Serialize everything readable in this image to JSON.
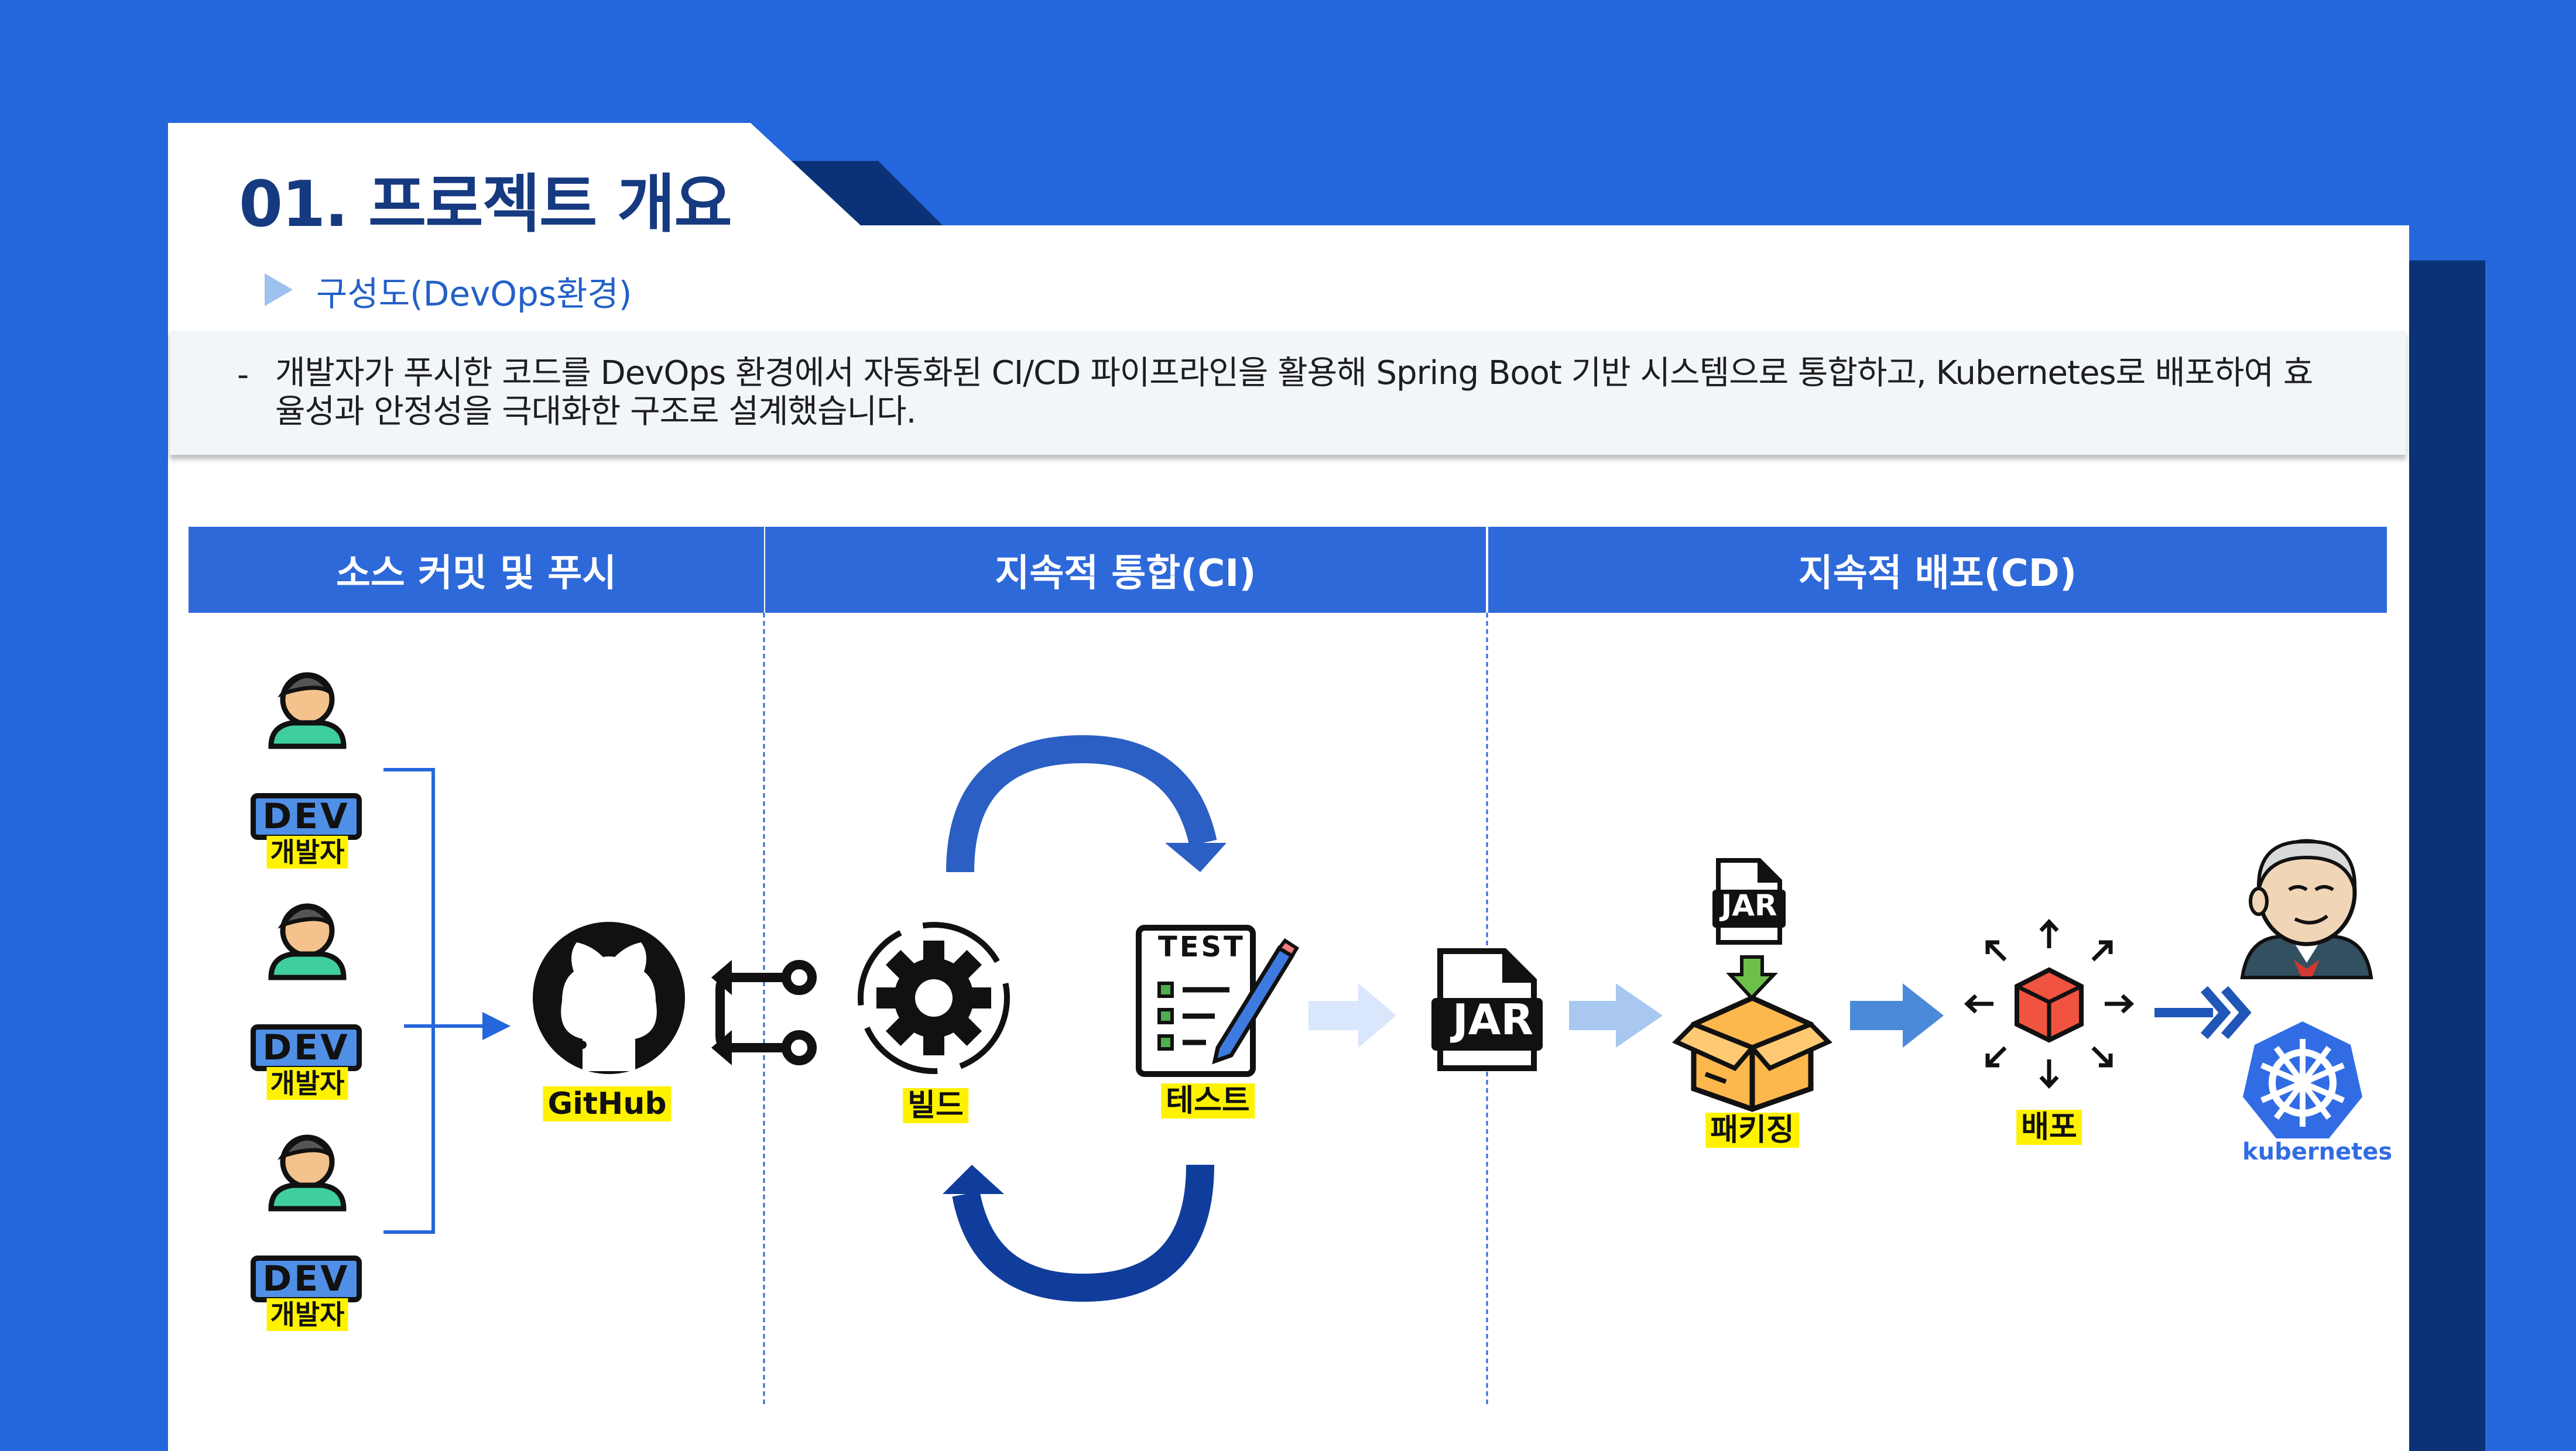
{
  "header": {
    "title": "01. 프로젝트 개요",
    "subtitle": "구성도(DevOps환경)"
  },
  "description": {
    "bullet": "-",
    "text": "개발자가 푸시한 코드를 DevOps 환경에서 자동화된 CI/CD 파이프라인을 활용해 Spring Boot 기반 시스템으로 통합하고, Kubernetes로 배포하여 효율성과 안정성을 극대화한 구조로 설계했습니다."
  },
  "phases": [
    {
      "label": "소스 커밋 및 푸시"
    },
    {
      "label": "지속적 통합(CI)"
    },
    {
      "label": "지속적 배포(CD)"
    }
  ],
  "developers": [
    {
      "badge": "DEV",
      "label": "개발자"
    },
    {
      "badge": "DEV",
      "label": "개발자"
    },
    {
      "badge": "DEV",
      "label": "개발자"
    }
  ],
  "nodes": {
    "github": "GitHub",
    "build": "빌드",
    "test": "테스트",
    "test_doc": "TEST",
    "jar": "JAR",
    "packaging": "패키징",
    "deploy": "배포",
    "kubernetes": "kubernetes"
  },
  "colors": {
    "background_blue": "#2467dc",
    "dark_navy": "#0b3277",
    "title_navy": "#163a80",
    "phase_blue": "#2e69d9",
    "highlight_yellow": "#fff200",
    "box_orange": "#fcb74d",
    "cube_red": "#f0533f"
  }
}
